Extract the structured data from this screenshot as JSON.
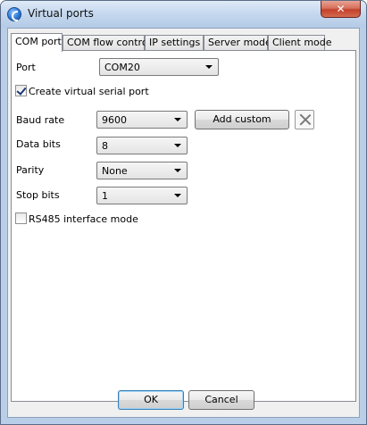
{
  "window": {
    "title": "Virtual ports",
    "close_label": "✕"
  },
  "tabs": [
    {
      "label": "COM port",
      "active": true
    },
    {
      "label": "COM flow control",
      "active": false
    },
    {
      "label": "IP settings",
      "active": false
    },
    {
      "label": "Server mode",
      "active": false
    },
    {
      "label": "Client mode",
      "active": false
    }
  ],
  "com_port": {
    "port_label": "Port",
    "port_value": "COM20",
    "create_virtual_label": "Create virtual serial port",
    "create_virtual_checked": true,
    "baud_rate_label": "Baud rate",
    "baud_rate_value": "9600",
    "add_custom_label": "Add custom",
    "data_bits_label": "Data bits",
    "data_bits_value": "8",
    "parity_label": "Parity",
    "parity_value": "None",
    "stop_bits_label": "Stop bits",
    "stop_bits_value": "1",
    "rs485_label": "RS485 interface mode",
    "rs485_checked": false
  },
  "footer": {
    "ok_label": "OK",
    "cancel_label": "Cancel"
  }
}
